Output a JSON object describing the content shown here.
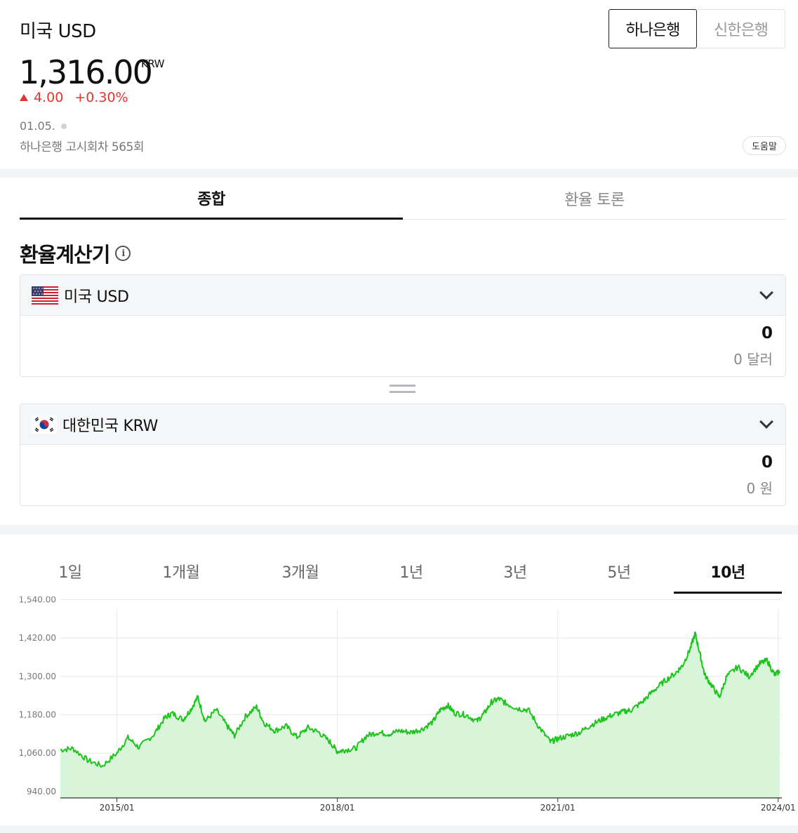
{
  "header": {
    "title": "미국 USD",
    "banks": [
      "하나은행",
      "신한은행"
    ],
    "rate": "1,316.00",
    "rate_unit": "KRW",
    "change": "4.00",
    "change_pct": "+0.30%",
    "date": "01.05.",
    "notice": "하나은행 고시회차 565회",
    "help": "도움말"
  },
  "tabs": [
    "종합",
    "환율 토론"
  ],
  "calculator": {
    "title": "환율계산기",
    "from": {
      "name": "미국 USD",
      "value": "0",
      "sub": "0 달러"
    },
    "to": {
      "name": "대한민국 KRW",
      "value": "0",
      "sub": "0 원"
    }
  },
  "periods": [
    "1일",
    "1개월",
    "3개월",
    "1년",
    "3년",
    "5년",
    "10년"
  ],
  "colors": {
    "up": "#e3342f",
    "line": "#1ec31e",
    "fill": "#d9f5d9"
  },
  "chart_data": {
    "type": "area",
    "title": "",
    "xlabel": "",
    "ylabel": "",
    "ylim": [
      920,
      1550
    ],
    "yticks": [
      "1,540.00",
      "1,420.00",
      "1,300.00",
      "1,180.00",
      "1,060.00",
      "940.00"
    ],
    "ytick_values": [
      1540,
      1420,
      1300,
      1180,
      1060,
      940
    ],
    "xticks": [
      "2015/01",
      "2018/01",
      "2021/01",
      "2024/01"
    ],
    "xtick_values": [
      2015.0,
      2018.0,
      2021.0,
      2024.0
    ],
    "grid": true,
    "x": [
      2014.23,
      2014.4,
      2014.6,
      2014.8,
      2015.0,
      2015.15,
      2015.3,
      2015.5,
      2015.65,
      2015.75,
      2015.9,
      2016.0,
      2016.1,
      2016.2,
      2016.35,
      2016.5,
      2016.6,
      2016.75,
      2016.9,
      2017.0,
      2017.15,
      2017.3,
      2017.45,
      2017.6,
      2017.75,
      2017.9,
      2018.0,
      2018.1,
      2018.25,
      2018.4,
      2018.55,
      2018.7,
      2018.85,
      2019.0,
      2019.15,
      2019.3,
      2019.4,
      2019.5,
      2019.6,
      2019.75,
      2019.9,
      2020.0,
      2020.1,
      2020.2,
      2020.3,
      2020.45,
      2020.6,
      2020.75,
      2020.9,
      2021.0,
      2021.15,
      2021.3,
      2021.45,
      2021.6,
      2021.75,
      2021.9,
      2022.0,
      2022.15,
      2022.3,
      2022.45,
      2022.6,
      2022.7,
      2022.8,
      2022.87,
      2022.93,
      2023.0,
      2023.1,
      2023.2,
      2023.3,
      2023.45,
      2023.6,
      2023.75,
      2023.85,
      2023.95,
      2024.02
    ],
    "values": [
      1070,
      1075,
      1038,
      1020,
      1060,
      1108,
      1078,
      1118,
      1170,
      1185,
      1165,
      1195,
      1235,
      1160,
      1195,
      1145,
      1115,
      1175,
      1205,
      1155,
      1130,
      1145,
      1110,
      1140,
      1125,
      1095,
      1065,
      1070,
      1075,
      1115,
      1125,
      1120,
      1130,
      1125,
      1135,
      1158,
      1195,
      1210,
      1185,
      1180,
      1160,
      1185,
      1220,
      1230,
      1215,
      1200,
      1195,
      1140,
      1095,
      1105,
      1115,
      1125,
      1148,
      1165,
      1180,
      1190,
      1195,
      1220,
      1255,
      1285,
      1310,
      1335,
      1385,
      1435,
      1375,
      1305,
      1270,
      1235,
      1300,
      1330,
      1300,
      1340,
      1350,
      1305,
      1316
    ]
  }
}
